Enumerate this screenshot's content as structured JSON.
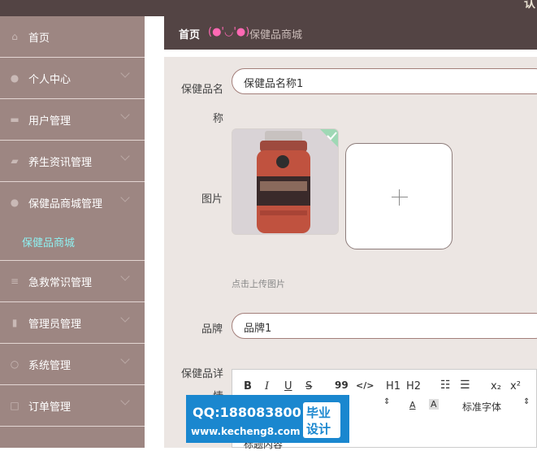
{
  "topbar": {
    "right_text": "认"
  },
  "sidebar": {
    "items": [
      {
        "label": "首页",
        "icon": "home-icon"
      },
      {
        "label": "个人中心",
        "icon": "user-icon"
      },
      {
        "label": "用户管理",
        "icon": "monitor-icon"
      },
      {
        "label": "养生资讯管理",
        "icon": "car-icon"
      },
      {
        "label": "保健品商城管理",
        "icon": "user-icon"
      },
      {
        "label": "急救常识管理",
        "icon": "list-icon"
      },
      {
        "label": "管理员管理",
        "icon": "bar-chart-icon"
      },
      {
        "label": "系统管理",
        "icon": "gear-icon"
      },
      {
        "label": "订单管理",
        "icon": "document-icon"
      }
    ],
    "sub_item": {
      "label": "保健品商城"
    }
  },
  "breadcrumb": {
    "home": "首页",
    "face": "(●'◡'●)",
    "current": "保健品商城"
  },
  "form": {
    "name_label": "保健品名称",
    "name_value": "保健品名称1",
    "image_label": "图片",
    "upload_hint": "点击上传图片",
    "brand_label": "品牌",
    "brand_value": "品牌1",
    "detail_label": "保健品详情"
  },
  "editor": {
    "toolbar": [
      "B",
      "I",
      "U",
      "S",
      "99",
      "</>",
      "H1",
      "H2",
      "ordered-list-icon",
      "bullet-list-icon",
      "x₂",
      "x²"
    ],
    "font_label": "标准字体",
    "content_partial": "标题内容"
  },
  "watermark": {
    "qq": "QQ:188083800",
    "url": "www.kecheng8.com",
    "badge_line1": "毕业",
    "badge_line2": "设计"
  },
  "colors": {
    "sidebar_bg": "#9d8682",
    "header_bg": "#534444",
    "active_sub": "#8ff0f0",
    "form_bg": "#ece6e3",
    "input_border": "#a37f7a",
    "face_pink": "#ff69b4"
  }
}
